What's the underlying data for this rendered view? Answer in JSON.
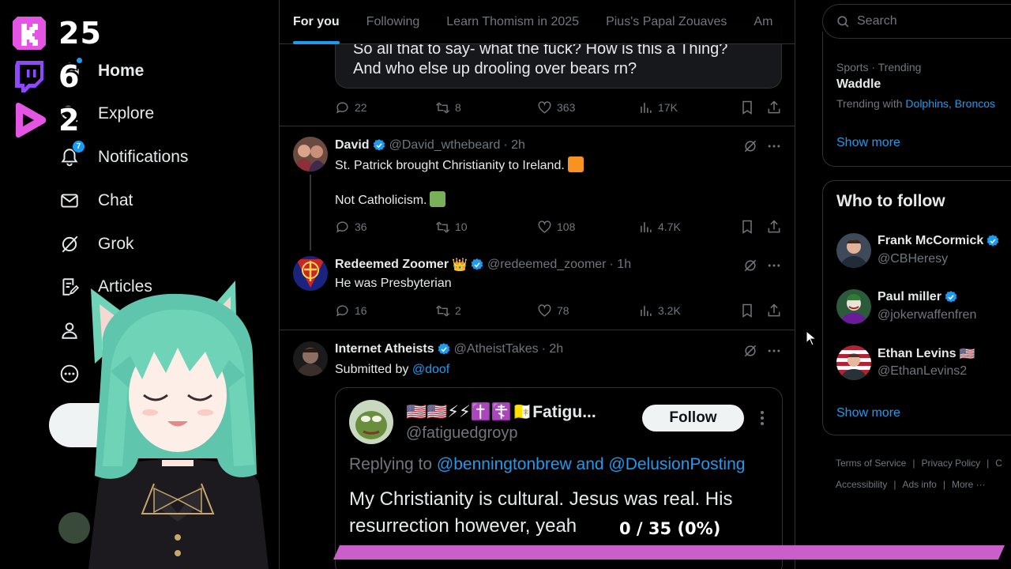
{
  "overlay": {
    "kick_count": "25",
    "twitch_count": "6",
    "youtube_count": "2"
  },
  "nav": {
    "home": "Home",
    "explore": "Explore",
    "notifications": "Notifications",
    "notifications_badge": "7",
    "chat": "Chat",
    "grok": "Grok",
    "articles": "Articles"
  },
  "tabs": [
    "For you",
    "Following",
    "Learn Thomism in 2025",
    "Pius's Papal Zouaves",
    "Am"
  ],
  "feed": {
    "quote_tail": {
      "line1": "So all that to say- what the fuck? How is this a Thing?",
      "line2": "And who else up drooling over bears rn?",
      "replies": "22",
      "reposts": "8",
      "likes": "363",
      "views": "17K"
    },
    "tweet1": {
      "name": "David",
      "handle": "@David_wthebeard",
      "time": "· 2h",
      "text1": "St. Patrick brought Christianity to Ireland.",
      "text2": "Not Catholicism.",
      "replies": "36",
      "reposts": "10",
      "likes": "108",
      "views": "4.7K"
    },
    "tweet2": {
      "name": "Redeemed Zoomer",
      "crown": "👑",
      "handle": "@redeemed_zoomer",
      "time": "· 1h",
      "text": "He was Presbyterian",
      "replies": "16",
      "reposts": "2",
      "likes": "78",
      "views": "3.2K"
    },
    "tweet3": {
      "name": "Internet Atheists",
      "handle": "@AtheistTakes",
      "time": "· 2h",
      "submitted_prefix": "Submitted by",
      "submitted_by": "@doof",
      "embed": {
        "name": "🇺🇸🇺🇸⚡⚡✝️☦️🇻🇦Fatigu...",
        "handle": "@fatiguedgroyp",
        "follow_label": "Follow",
        "reply_prefix": "Replying to",
        "reply_to": "@benningtonbrew and @DelusionPosting",
        "body": "My Christianity is cultural. Jesus was real. His resurrection however, yeah"
      }
    }
  },
  "progress": {
    "label": "0 / 35 (0%)",
    "value": 0,
    "max": 35
  },
  "search": {
    "placeholder": "Search"
  },
  "trending": {
    "meta": "Sports · Trending",
    "title": "Waddle",
    "with_prefix": "Trending with",
    "with_links": "Dolphins, Broncos",
    "show_more": "Show more"
  },
  "who_to_follow": {
    "title": "Who to follow",
    "users": [
      {
        "name": "Frank McCormick",
        "handle": "@CBHeresy"
      },
      {
        "name": "Paul miller",
        "handle": "@jokerwaffenfren"
      },
      {
        "name": "Ethan Levins",
        "flag": "🇺🇸",
        "handle": "@EthanLevins2"
      }
    ],
    "show_more": "Show more"
  },
  "footer": {
    "terms": "Terms of Service",
    "privacy": "Privacy Policy",
    "cookie": "C",
    "accessibility": "Accessibility",
    "ads": "Ads info",
    "more": "More ···"
  },
  "colors": {
    "accent": "#1d9bf0",
    "kick": "#e455e4",
    "twitch": "#9146ff",
    "progress": "#ff82ff",
    "orange_square": "#f7931e",
    "green_square": "#78b159"
  }
}
